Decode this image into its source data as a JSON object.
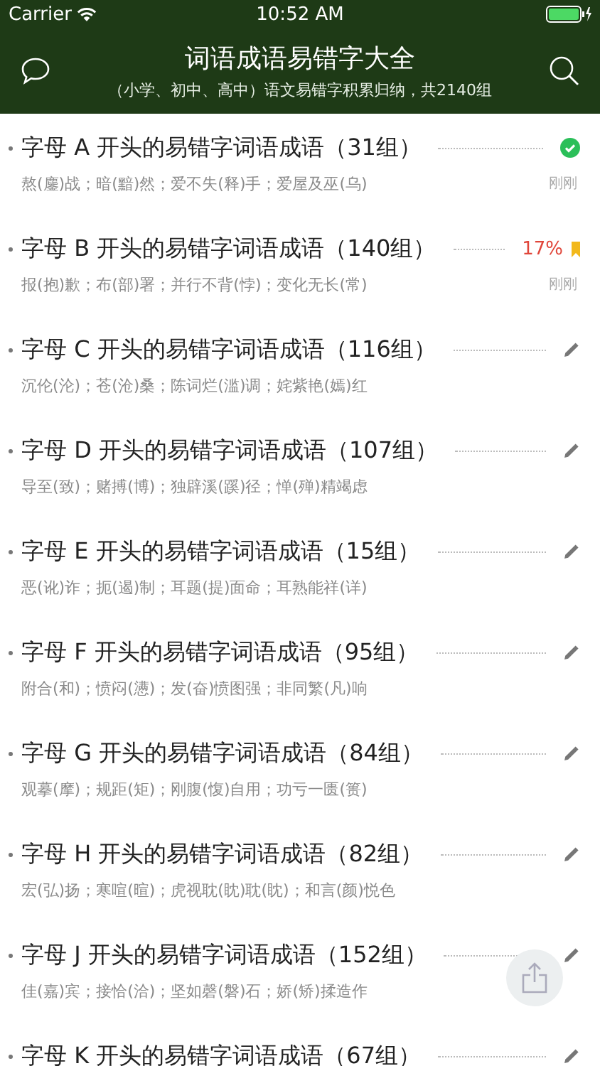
{
  "status_bar": {
    "carrier": "Carrier",
    "time": "10:52 AM"
  },
  "header": {
    "title": "词语成语易错字大全",
    "subtitle": "（小学、初中、高中）语文易错字积累归纳，共2140组"
  },
  "rows": [
    {
      "title": "字母 A 开头的易错字词语成语（31组）",
      "examples": "熬(鏖)战；暗(黯)然；爱不失(释)手；爱屋及巫(乌)",
      "kind": "done",
      "time": "刚刚"
    },
    {
      "title": "字母 B 开头的易错字词语成语（140组）",
      "examples": "报(抱)歉；布(部)署；并行不背(悖)；变化无长(常)",
      "kind": "progress",
      "progress": "17%",
      "time": "刚刚"
    },
    {
      "title": "字母 C 开头的易错字词语成语（116组）",
      "examples": "沉伦(沦)；苍(沧)桑；陈词烂(滥)调；姹紫艳(嫣)红",
      "kind": "edit"
    },
    {
      "title": "字母 D 开头的易错字词语成语（107组）",
      "examples": "导至(致)；赌搏(博)；独辟溪(蹊)径；惮(殚)精竭虑",
      "kind": "edit"
    },
    {
      "title": "字母 E 开头的易错字词语成语（15组）",
      "examples": "恶(讹)诈；扼(遏)制；耳题(提)面命；耳熟能祥(详)",
      "kind": "edit"
    },
    {
      "title": "字母 F 开头的易错字词语成语（95组）",
      "examples": "附合(和)；愤闷(懑)；发(奋)愤图强；非同繁(凡)响",
      "kind": "edit"
    },
    {
      "title": "字母 G 开头的易错字词语成语（84组）",
      "examples": "观摹(摩)；规距(矩)；刚腹(愎)自用；功亏一匮(篑)",
      "kind": "edit"
    },
    {
      "title": "字母 H 开头的易错字词语成语（82组）",
      "examples": "宏(弘)扬；寒喧(暄)；虎视耽(眈)耽(眈)；和言(颜)悦色",
      "kind": "edit"
    },
    {
      "title": "字母 J 开头的易错字词语成语（152组）",
      "examples": "佳(嘉)宾；接恰(洽)；坚如磬(磐)石；娇(矫)揉造作",
      "kind": "edit"
    },
    {
      "title": "字母 K 开头的易错字词语成语（67组）",
      "kind": "edit"
    }
  ]
}
